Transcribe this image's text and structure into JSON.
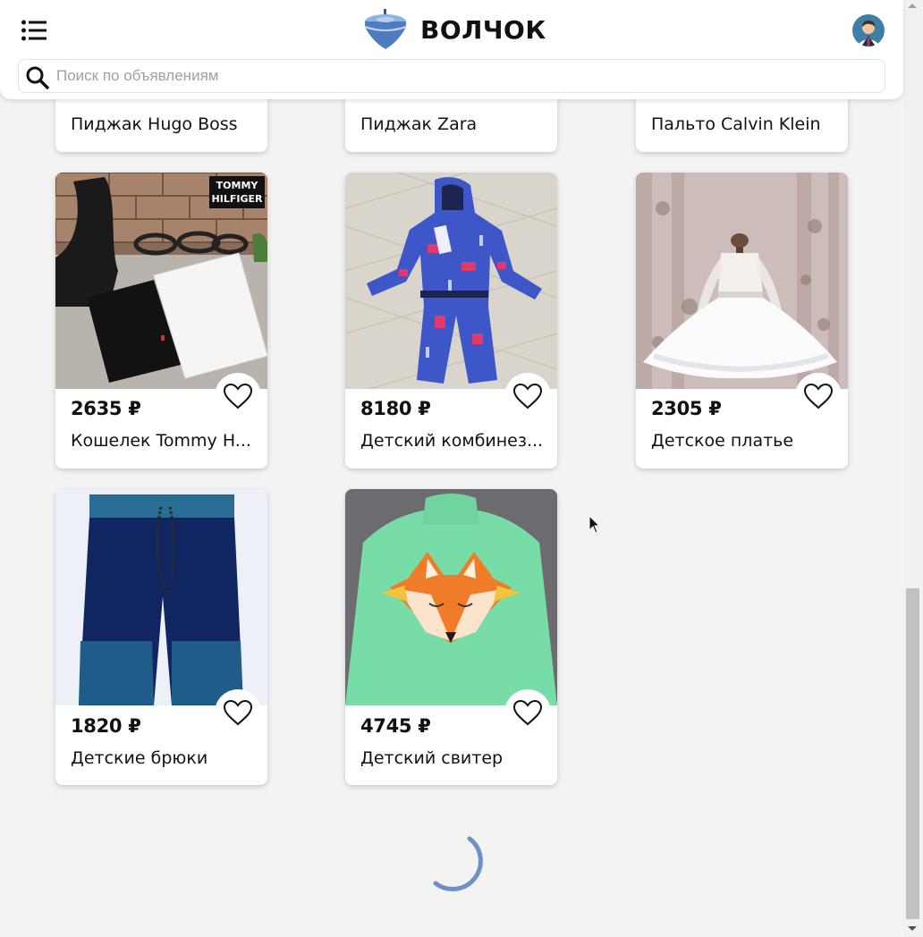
{
  "header": {
    "logo_text": "ВОЛЧОК",
    "search_placeholder": "Поиск по объявлениям"
  },
  "listings": [
    {
      "name": "Пиджак Hugo Boss"
    },
    {
      "name": "Пиджак Zara"
    },
    {
      "name": "Пальто Calvin Klein"
    },
    {
      "price": "2635 ₽",
      "name": "Кошелек Tommy H...",
      "photo_text": "TOMMY HILFIGER"
    },
    {
      "price": "8180 ₽",
      "name": "Детский комбинез..."
    },
    {
      "price": "2305 ₽",
      "name": "Детское платье"
    },
    {
      "price": "1820 ₽",
      "name": "Детские брюки"
    },
    {
      "price": "4745 ₽",
      "name": "Детский свитер"
    }
  ],
  "colors": {
    "accent": "#6f8fc7",
    "background": "#f3f3f3",
    "card": "#ffffff"
  },
  "icons": {
    "menu": "list-icon",
    "search": "search-icon",
    "favorite": "heart-icon",
    "loading": "spinner-icon"
  }
}
